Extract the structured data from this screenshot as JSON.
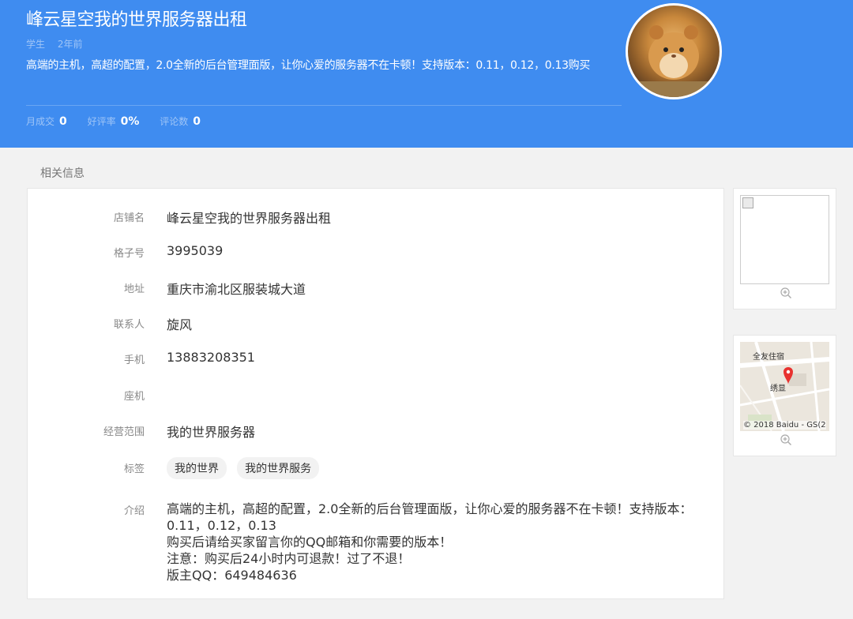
{
  "header": {
    "title": "峰云星空我的世界服务器出租",
    "role": "学生",
    "time": "2年前",
    "description": "高端的主机，高超的配置，2.0全新的后台管理面版，让你心爱的服务器不在卡顿！支持版本：0.11，0.12，0.13购买",
    "stats": [
      {
        "label": "月成交",
        "value": "0"
      },
      {
        "label": "好评率",
        "value": "0%"
      },
      {
        "label": "评论数",
        "value": "0"
      }
    ]
  },
  "section_title": "相关信息",
  "info": {
    "shop_name_label": "店铺名",
    "shop_name": "峰云星空我的世界服务器出租",
    "id_label": "格子号",
    "id": "3995039",
    "address_label": "地址",
    "address": "重庆市渝北区服装城大道",
    "contact_label": "联系人",
    "contact": "旋风",
    "phone_label": "手机",
    "phone": "13883208351",
    "landline_label": "座机",
    "landline": "",
    "scope_label": "经营范围",
    "scope": "我的世界服务器",
    "tags_label": "标签",
    "tags": [
      "我的世界",
      "我的世界服务"
    ],
    "intro_label": "介绍",
    "intro": "高端的主机，高超的配置，2.0全新的后台管理面版，让你心爱的服务器不在卡顿！支持版本：0.11，0.12，0.13\n购买后请给买家留言你的QQ邮箱和你需要的版本！\n注意：购买后24小时内可退款！过了不退！\n版主QQ：649484636"
  },
  "map": {
    "copyright": "© 2018 Baidu - GS(2",
    "poi_1": "全友住宿",
    "poi_2": "绣显"
  },
  "icons": {
    "zoom": "zoom-in-icon",
    "marker": "map-marker-icon"
  }
}
